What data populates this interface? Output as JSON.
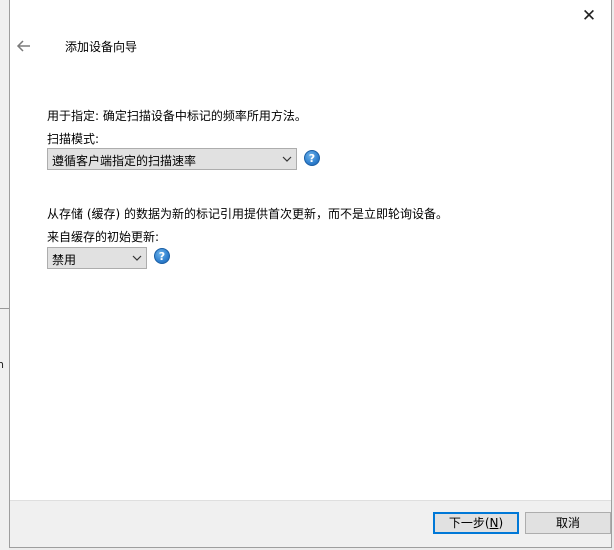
{
  "window": {
    "title": "添加设备向导",
    "close_glyph": "✕"
  },
  "section1": {
    "description": "用于指定: 确定扫描设备中标记的频率所用方法。",
    "label": "扫描模式:",
    "selected": "遵循客户端指定的扫描速率"
  },
  "section2": {
    "description": "从存储 (缓存) 的数据为新的标记引用提供首次更新，而不是立即轮询设备。",
    "label": "来自缓存的初始更新:",
    "selected": "禁用"
  },
  "help": {
    "glyph": "?"
  },
  "background": {
    "fragment": "n"
  },
  "footer": {
    "next_prefix": "下一步(",
    "next_accel": "N",
    "next_suffix": ")",
    "cancel_label": "取消"
  }
}
